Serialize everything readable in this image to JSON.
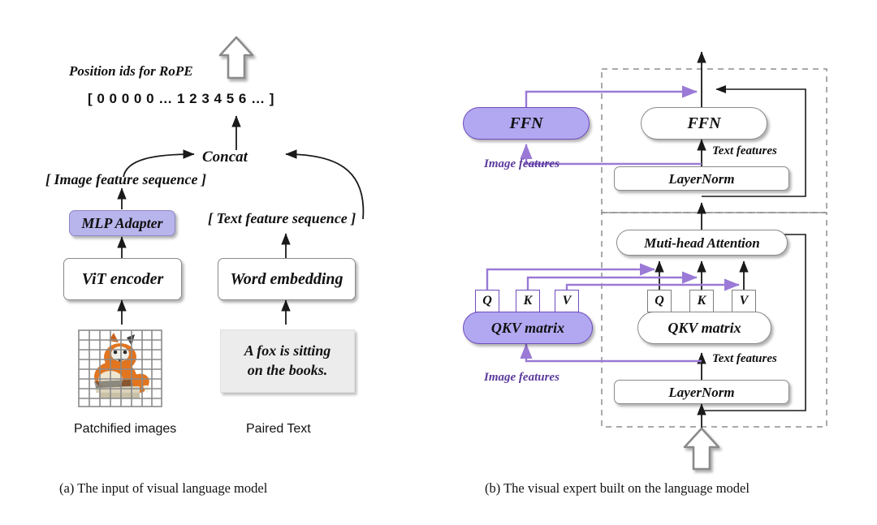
{
  "figure": {
    "panel_a": {
      "caption": "(a) The input of visual language model",
      "title": "Position ids for RoPE",
      "position_ids": "[ 0  0  0  0  0  …  1  2  3  4  5  6  …  ]",
      "concat_label": "Concat",
      "image_feature_seq": "[ Image feature sequence ]",
      "text_feature_seq": "[ Text  feature sequence ]",
      "mlp_adapter": "MLP Adapter",
      "vit_encoder": "ViT encoder",
      "word_embedding": "Word embedding",
      "sample_text_line1": "A fox is sitting",
      "sample_text_line2": "on the books.",
      "patchified_caption": "Patchified images",
      "paired_text_caption": "Paired Text",
      "up_arrow_icon": "hollow-up-arrow-icon"
    },
    "panel_b": {
      "caption": "(b) The visual expert built on the language model",
      "ffn_image": "FFN",
      "ffn_text": "FFN",
      "layernorm_top": "LayerNorm",
      "layernorm_bottom": "LayerNorm",
      "attention": "Muti-head Attention",
      "qkv_image": "QKV matrix",
      "qkv_text": "QKV matrix",
      "qkv_heads": [
        "Q",
        "K",
        "V"
      ],
      "image_features_top": "Image features",
      "text_features_top": "Text features",
      "image_features_bottom": "Image features",
      "text_features_bottom": "Text features",
      "up_arrow_icon": "hollow-up-arrow-icon"
    },
    "colors": {
      "purple_fill": "#b2a8f2",
      "purple_border": "#6f4bbd",
      "purple_light_fill": "#b8b4ec",
      "purple_arrow": "#9a7ad6",
      "purple_text": "#5a3a9c",
      "box_border": "#8a8a8a",
      "dashed_border": "#8d8d8d",
      "text": "#111111",
      "textbox_bg": "#ececec",
      "fox_orange": "#e2751f",
      "grid_gray": "#8a8a8a"
    }
  }
}
